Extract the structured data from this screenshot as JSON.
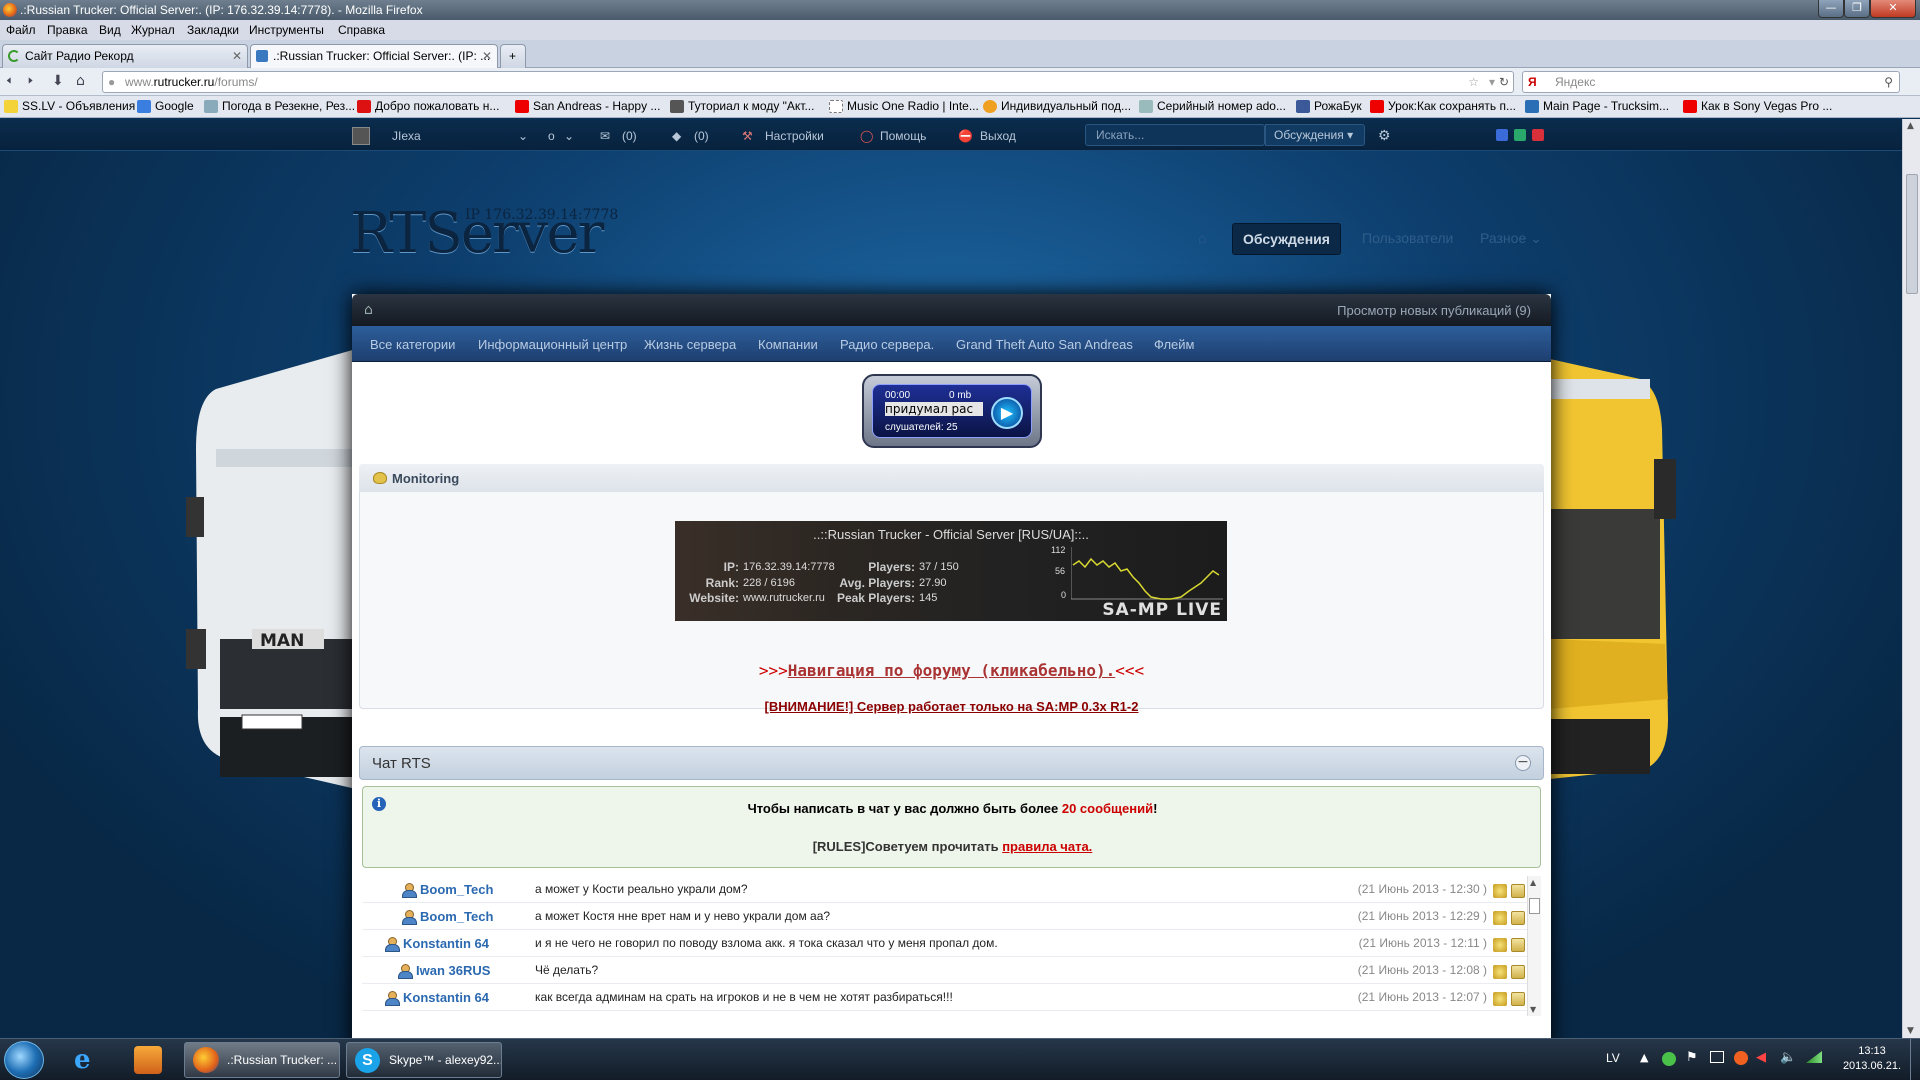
{
  "window": {
    "title": ".:Russian Trucker: Official Server:. (IP: 176.32.39.14:7778). - Mozilla Firefox"
  },
  "menu": [
    "Файл",
    "Правка",
    "Вид",
    "Журнал",
    "Закладки",
    "Инструменты",
    "Справка"
  ],
  "tabs": [
    {
      "label": "Сайт Радио Рекорд",
      "active": false
    },
    {
      "label": ".:Russian Trucker: Official Server:. (IP: ...",
      "active": true
    }
  ],
  "url": {
    "prefix": "www.",
    "domain": "rutrucker.ru",
    "path": "/forums/"
  },
  "search": {
    "placeholder": "Яндекс"
  },
  "bookmarks": [
    "SS.LV - Объявления",
    "Google",
    "Погода в Резекне, Рез...",
    "Добро пожаловать н...",
    "San Andreas - Happy ...",
    "Туториал к моду \"Акт...",
    "Music One Radio | Inte...",
    "Индивидуальный под...",
    "Серийный номер ado...",
    "РожаБук",
    "Урок:Как сохранять п...",
    "Main Page - Trucksim...",
    "Как в Sony Vegas Pro ..."
  ],
  "forum_top": {
    "username": "JIexa",
    "zero": "o",
    "messages": "(0)",
    "alerts": "(0)",
    "settings": "Настройки",
    "help": "Помощь",
    "logout": "Выход",
    "search_placeholder": "Искать...",
    "search_scope": "Обсуждения"
  },
  "header": {
    "logo": "RTServer",
    "ip": "IP 176.32.39.14:7778",
    "nav": [
      {
        "label": "Обсуждения",
        "active": true
      },
      {
        "label": "Пользователи"
      },
      {
        "label": "Разное"
      }
    ]
  },
  "breadcrumb": {
    "new_posts": "Просмотр новых публикаций (9)"
  },
  "categories": [
    "Все категории",
    "Информационный центр",
    "Жизнь сервера",
    "Компании",
    "Радио сервера.",
    "Grand Theft Auto San Andreas",
    "Флейм"
  ],
  "radio": {
    "time": "00:00",
    "size": "0 mb",
    "track": "придумал рас",
    "listeners": "слушателей: 25"
  },
  "monitoring": {
    "title": "Monitoring",
    "banner_title": "..::Russian Trucker - Official Server [RUS/UA]::..",
    "ip_label": "IP:",
    "ip": "176.32.39.14:7778",
    "rank_label": "Rank:",
    "rank": "228 / 6196",
    "website_label": "Website:",
    "website": "www.rutrucker.ru",
    "players_label": "Players:",
    "players": "37 / 150",
    "avg_label": "Avg. Players:",
    "avg": "27.90",
    "peak_label": "Peak Players:",
    "peak": "145",
    "graph_max": "112",
    "graph_mid": "56",
    "graph_min": "0",
    "brand": "SA-MP LIVE"
  },
  "nav_link": {
    "prefix": ">>>",
    "text": "Навигация по форуму (кликабельно).",
    "suffix": "<<<"
  },
  "warning": "[ВНИМАНИЕ!] Сервер работает только на SA:MP 0.3x R1-2",
  "chat": {
    "title": "Чат RTS",
    "notice_pre": "Чтобы написать в чат у вас должно быть более ",
    "notice_red": "20 сообщений",
    "notice_post": "!",
    "rules_pre": "[RULES]Советуем прочитать ",
    "rules_link": "правила чата.",
    "messages": [
      {
        "user": "Boom_Tech",
        "text": "а может у Кости реально украли дом?",
        "date": "(21 Июнь 2013 - 12:30 )"
      },
      {
        "user": "Boom_Tech",
        "text": "а может Костя нне врет нам и у нево украли дом аа?",
        "date": "(21 Июнь 2013 - 12:29 )"
      },
      {
        "user": "Konstantin 64",
        "text": "и я не чего не говорил по поводу взлома акк. я тока сказал что у меня пропал дом.",
        "date": "(21 Июнь 2013 - 12:11 )"
      },
      {
        "user": "Iwan 36RUS",
        "text": "Чё делать?",
        "date": "(21 Июнь 2013 - 12:08 )"
      },
      {
        "user": "Konstantin 64",
        "text": "как всегда админам на срать на игроков и не в чем не хотят разбираться!!!",
        "date": "(21 Июнь 2013 - 12:07 )"
      }
    ]
  },
  "taskbar": {
    "apps": [
      {
        "label": ".:Russian Trucker: ..."
      },
      {
        "label": "Skype™ - alexey92..."
      }
    ],
    "lang": "LV",
    "time": "13:13",
    "date": "2013.06.21."
  }
}
